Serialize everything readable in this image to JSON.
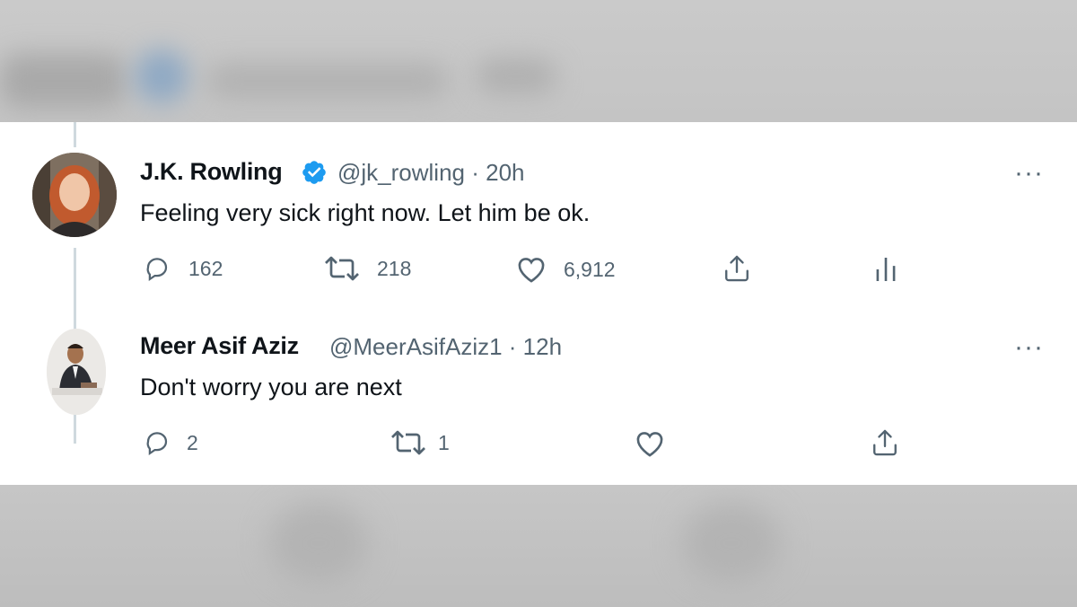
{
  "tweets": [
    {
      "author": "J.K. Rowling",
      "handle": "@jk_rowling",
      "time": "· 20h",
      "verified": true,
      "text": "Feeling very sick right now. Let him be ok.",
      "more": "···",
      "stats": {
        "replies": "162",
        "retweets": "218",
        "likes": "6,912"
      }
    },
    {
      "author": "Meer Asif Aziz",
      "handle": "@MeerAsifAziz1",
      "time": "· 12h",
      "verified": false,
      "text": "Don't worry you are next",
      "more": "···",
      "stats": {
        "replies": "2",
        "retweets": "1"
      }
    }
  ],
  "colors": {
    "verified": "#1d9bf0",
    "secondary": "#536471",
    "primary": "#0f1419",
    "thread_line": "#cfd9de"
  },
  "icons": [
    "reply-icon",
    "retweet-icon",
    "like-icon",
    "share-icon",
    "analytics-icon",
    "verified-badge-icon",
    "more-icon"
  ]
}
